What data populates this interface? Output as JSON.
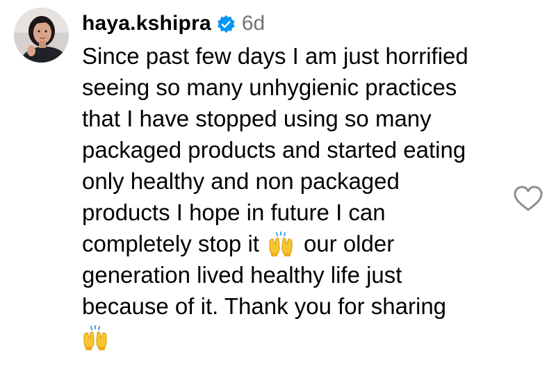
{
  "comment": {
    "username": "haya.kshipra",
    "verified_icon": "verified-badge-icon",
    "time": "6d",
    "lines": [
      "Since past few days I am just horrified",
      "seeing so many unhygienic practices",
      "that I have stopped using so many",
      "packaged products and started eating",
      "only healthy and non packaged",
      "products I hope in future I can",
      "completely stop it",
      "our older",
      "generation lived healthy life just",
      "because of it. Thank you for sharing"
    ],
    "emoji_icon": "raising-hands-emoji",
    "like_icon": "heart-outline-icon"
  },
  "colors": {
    "verified_blue": "#0095f6",
    "time_gray": "#737373",
    "heart_gray": "#8e8e8e",
    "emoji_yellow": "#f7c52f"
  }
}
